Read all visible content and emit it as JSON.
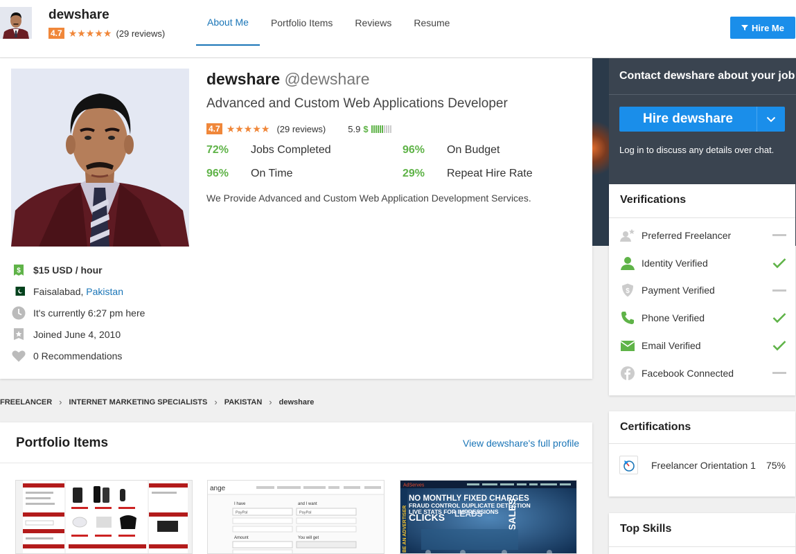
{
  "header": {
    "name": "dewshare",
    "rating": "4.7",
    "reviews": "(29 reviews)",
    "tabs": [
      {
        "label": "About Me",
        "active": true
      },
      {
        "label": "Portfolio Items"
      },
      {
        "label": "Reviews"
      },
      {
        "label": "Resume"
      }
    ],
    "hire_button": "Hire Me"
  },
  "profile": {
    "display_name": "dewshare",
    "handle": "@dewshare",
    "tagline": "Advanced and Custom Web Applications Developer",
    "rating": "4.7",
    "reviews": "(29 reviews)",
    "score": "5.9",
    "score_dollar": "$",
    "score_fraction": 0.59,
    "stats": [
      {
        "pct": "72%",
        "label": "Jobs Completed"
      },
      {
        "pct": "96%",
        "label": "On Budget"
      },
      {
        "pct": "96%",
        "label": "On Time"
      },
      {
        "pct": "29%",
        "label": "Repeat Hire Rate"
      }
    ],
    "description": "We Provide Advanced and Custom Web Application Development Services.",
    "rate": "$15 USD / hour",
    "city": "Faisalabad,",
    "country": "Pakistan",
    "local_time": "It's currently 6:27 pm here",
    "joined": "Joined June 4, 2010",
    "recommendations": "0 Recommendations"
  },
  "contact": {
    "title": "Contact dewshare about your job",
    "hire_label": "Hire dewshare",
    "note": "Log in to discuss any details over chat."
  },
  "verifications": {
    "title": "Verifications",
    "items": [
      {
        "label": "Preferred Freelancer",
        "verified": false,
        "icon": "preferred-freelancer-icon"
      },
      {
        "label": "Identity Verified",
        "verified": true,
        "icon": "user-icon"
      },
      {
        "label": "Payment Verified",
        "verified": false,
        "icon": "shield-dollar-icon"
      },
      {
        "label": "Phone Verified",
        "verified": true,
        "icon": "phone-icon"
      },
      {
        "label": "Email Verified",
        "verified": true,
        "icon": "envelope-icon"
      },
      {
        "label": "Facebook Connected",
        "verified": false,
        "icon": "facebook-icon"
      }
    ]
  },
  "certifications": {
    "title": "Certifications",
    "items": [
      {
        "label": "Freelancer Orientation 1",
        "score": "75%"
      }
    ]
  },
  "skills": {
    "title": "Top Skills"
  },
  "breadcrumb": [
    "FREELANCER",
    "INTERNET MARKETING SPECIALISTS",
    "PAKISTAN",
    "dewshare"
  ],
  "portfolio": {
    "title": "Portfolio Items",
    "link": "View dewshare's full profile",
    "thumb3": {
      "headline1": "NO MONTHLY FIXED CHARGES",
      "headline2": "FRAUD CONTROL DUPLICATE DETECTION",
      "headline3": "LIVE STATS FOR IMPRESSIONS",
      "big1": "CLICKS",
      "big2": "LEADS",
      "side": "SALES",
      "vertical": "BE AN ADVERTISER",
      "brand": "AdServes"
    },
    "thumb2": {
      "brand": "ange",
      "have": "I have",
      "want": "and I want",
      "paypal": "PayPal",
      "amount": "Amount",
      "get": "You will get"
    }
  },
  "colors": {
    "accent": "#1a8eea",
    "link": "#1a75b7",
    "rating": "#f0873a",
    "success": "#5fb348"
  }
}
